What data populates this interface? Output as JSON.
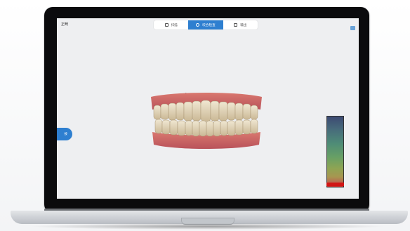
{
  "app": {
    "title": "正畸"
  },
  "workflow_steps": [
    {
      "label": "扫描",
      "icon": "document-icon",
      "active": false
    },
    {
      "label": "咬合检查",
      "icon": "search-icon",
      "active": true
    },
    {
      "label": "输出",
      "icon": "export-icon",
      "active": false
    }
  ],
  "side_panel_button": {
    "label": "按"
  },
  "colors": {
    "accent": "#2e7fd0",
    "screen_bg": "#eeeff1",
    "marker": "#d11515"
  }
}
